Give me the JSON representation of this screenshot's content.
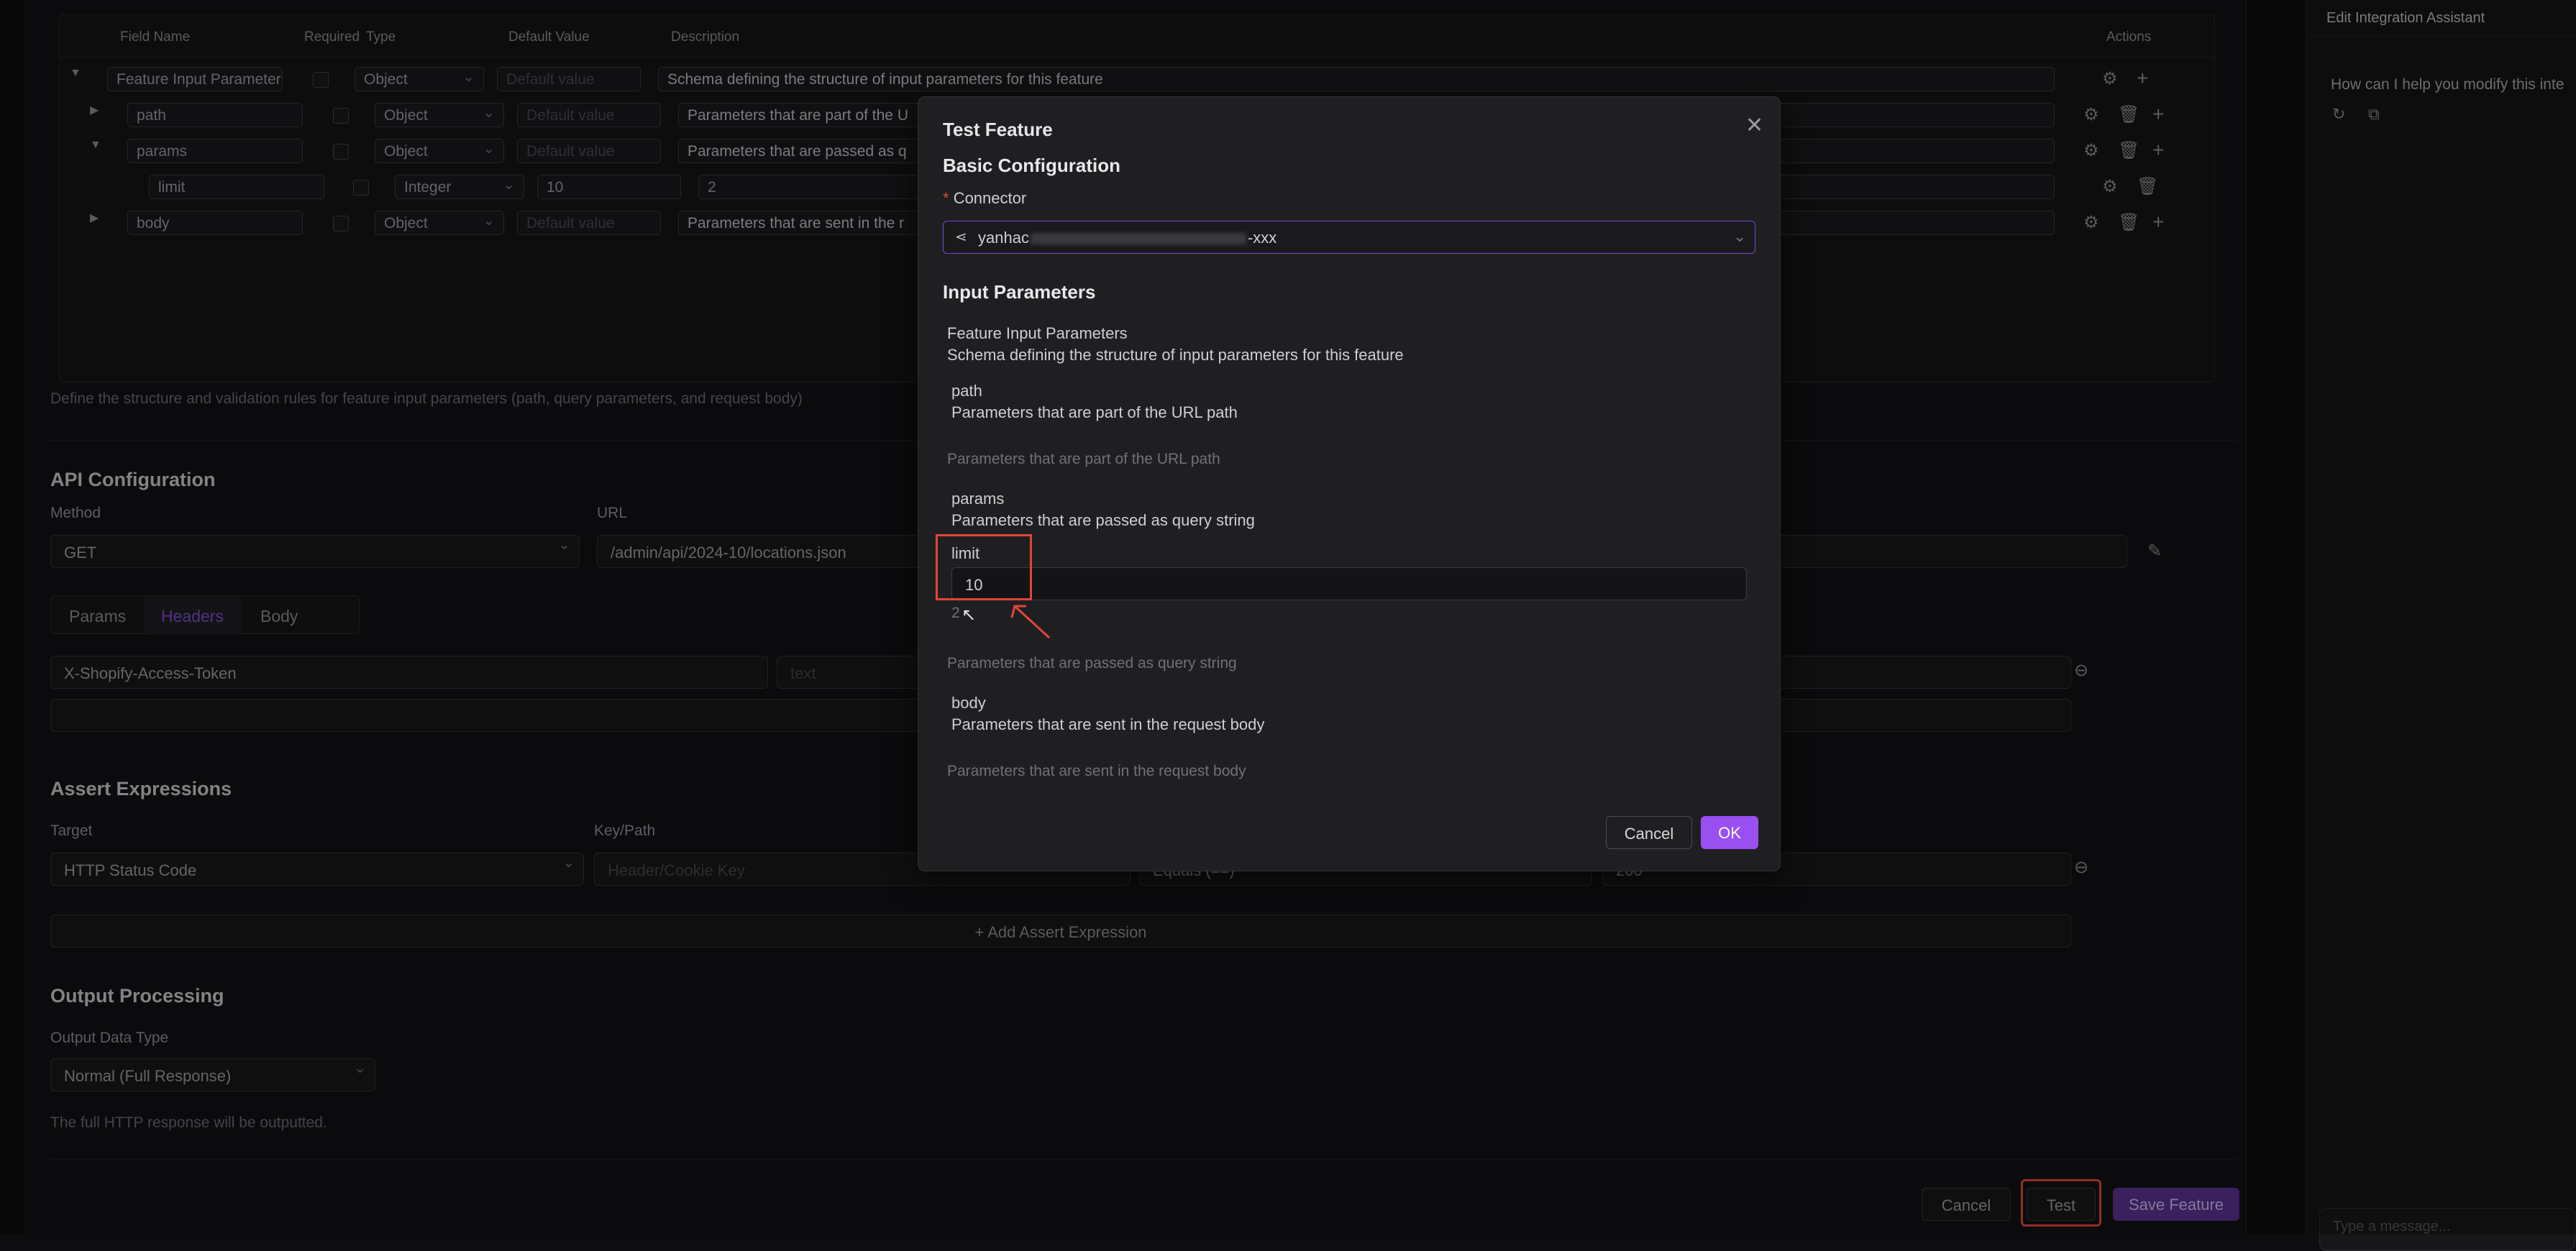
{
  "schema_table": {
    "headers": [
      "Field Name",
      "Required",
      "Type",
      "Default Value",
      "Description",
      "Actions"
    ],
    "rows": [
      {
        "name": "Feature Input Parameters",
        "type": "Object",
        "default_placeholder": "Default value",
        "description": "Schema defining the structure of input parameters for this feature"
      },
      {
        "name": "path",
        "type": "Object",
        "default_placeholder": "Default value",
        "description": "Parameters that are part of the U"
      },
      {
        "name": "params",
        "type": "Object",
        "default_placeholder": "Default value",
        "description": "Parameters that are passed as q"
      },
      {
        "name": "limit",
        "type": "Integer",
        "default_value": "10",
        "description": "2"
      },
      {
        "name": "body",
        "type": "Object",
        "default_placeholder": "Default value",
        "description": "Parameters that are sent in the r"
      }
    ],
    "helper": "Define the structure and validation rules for feature input parameters (path, query parameters, and request body)"
  },
  "api_config": {
    "title": "API Configuration",
    "method_label": "Method",
    "method_value": "GET",
    "url_label": "URL",
    "url_value": "/admin/api/2024-10/locations.json",
    "tabs": [
      "Params",
      "Headers",
      "Body"
    ],
    "header_key": "X-Shopify-Access-Token",
    "header_value_placeholder": "text"
  },
  "assert": {
    "title": "Assert Expressions",
    "target_label": "Target",
    "key_label": "Key/Path",
    "target_value": "HTTP Status Code",
    "key_placeholder": "Header/Cookie Key",
    "operator_value": "Equals (==)",
    "expected_value": "200",
    "add_label": "Add Assert Expression"
  },
  "output": {
    "title": "Output Processing",
    "type_label": "Output Data Type",
    "type_value": "Normal (Full Response)",
    "helper": "The full HTTP response will be outputted."
  },
  "footer": {
    "cancel": "Cancel",
    "test": "Test",
    "save": "Save Feature"
  },
  "sidebar": {
    "title": "Edit Integration Assistant",
    "greeting": "How can I help you modify this inte",
    "input_placeholder": "Type a message..."
  },
  "modal": {
    "title": "Test Feature",
    "basic_title": "Basic Configuration",
    "connector_label": "Connector",
    "connector_value_prefix": "yanhac",
    "connector_value_suffix": "-xxx",
    "input_title": "Input Parameters",
    "root_name": "Feature Input Parameters",
    "root_desc": "Schema defining the structure of input parameters for this feature",
    "path_name": "path",
    "path_desc": "Parameters that are part of the URL path",
    "path_help": "Parameters that are part of the URL path",
    "params_name": "params",
    "params_desc": "Parameters that are passed as query string",
    "limit_label": "limit",
    "limit_value": "10",
    "limit_desc": "2",
    "params_help": "Parameters that are passed as query string",
    "body_name": "body",
    "body_desc": "Parameters that are sent in the request body",
    "body_help": "Parameters that are sent in the request body",
    "cancel": "Cancel",
    "ok": "OK"
  },
  "colors": {
    "accent": "#9a4ff0",
    "highlight": "#e0453a"
  }
}
